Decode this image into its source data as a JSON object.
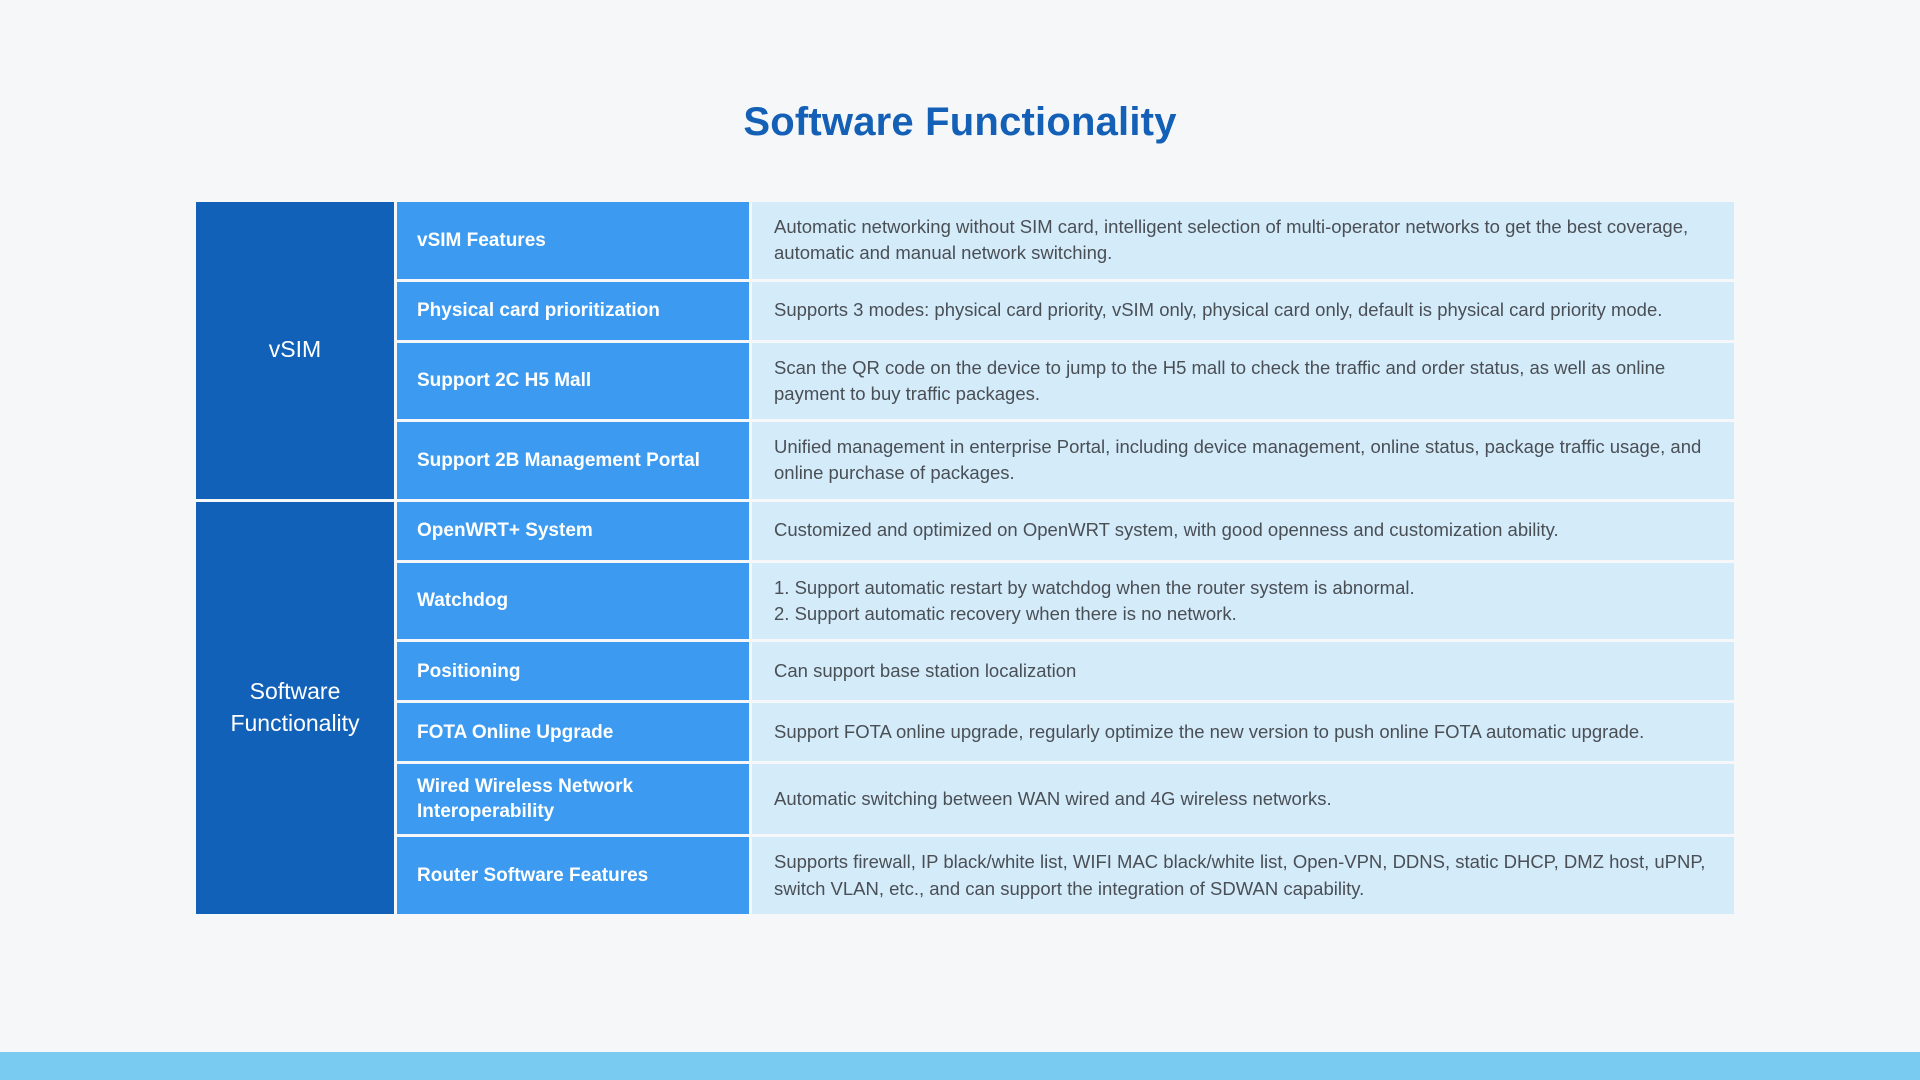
{
  "page": {
    "title": "Software Functionality",
    "background_color": "#f6f7f8",
    "title_color": "#1460b6",
    "accent_dark_blue": "#1261b8",
    "accent_mid_blue": "#3c9bf0",
    "accent_light_blue": "#d4ebfa",
    "bottom_bar_color": "#79cbf2"
  },
  "table": {
    "sections": [
      {
        "label": "vSIM",
        "rows": [
          {
            "feature": "vSIM Features",
            "description": "Automatic networking without SIM card, intelligent selection of multi-operator networks to get the best coverage, automatic and manual network switching."
          },
          {
            "feature": "Physical card prioritization",
            "description": "Supports 3 modes: physical card priority, vSIM only, physical card only, default is physical card priority mode."
          },
          {
            "feature": "Support 2C H5 Mall",
            "description": "Scan the QR code on the device to jump to the H5 mall to check the traffic and order status, as well as online payment to buy traffic packages."
          },
          {
            "feature": "Support 2B Management Portal",
            "description": "Unified management in enterprise Portal, including device management, online status, package traffic usage, and online purchase of packages."
          }
        ]
      },
      {
        "label": "Software Functionality",
        "rows": [
          {
            "feature": "OpenWRT+ System",
            "description": "Customized and optimized on OpenWRT system, with good openness and customization ability."
          },
          {
            "feature": "Watchdog",
            "description": "1. Support automatic restart by watchdog when the router system is abnormal.\n2. Support automatic recovery when there is no network."
          },
          {
            "feature": "Positioning",
            "description": "Can support base station localization"
          },
          {
            "feature": "FOTA Online Upgrade",
            "description": "Support FOTA online upgrade, regularly optimize the new version to push online FOTA automatic upgrade."
          },
          {
            "feature": "Wired Wireless Network Interoperability",
            "description": "Automatic switching between WAN wired and 4G wireless networks."
          },
          {
            "feature": "Router Software Features",
            "description": "Supports firewall, IP black/white list, WIFI MAC black/white list, Open-VPN, DDNS, static DHCP, DMZ host, uPNP, switch VLAN, etc., and can support the integration of SDWAN capability."
          }
        ]
      }
    ]
  }
}
